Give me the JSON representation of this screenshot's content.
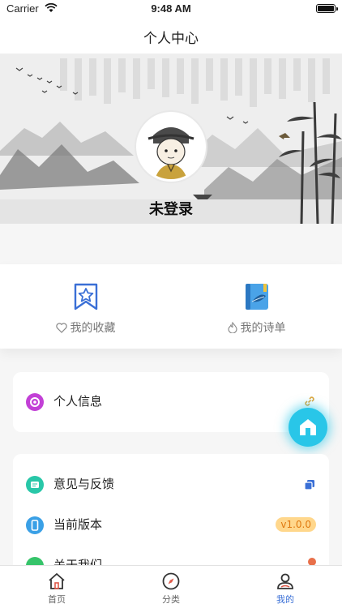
{
  "status_bar": {
    "carrier": "Carrier",
    "time": "9:48 AM"
  },
  "nav": {
    "title": "个人中心"
  },
  "banner": {
    "login_label": "未登录"
  },
  "favorites": {
    "collection_label": "我的收藏",
    "poem_list_label": "我的诗单"
  },
  "menu": {
    "personal_info": "个人信息",
    "feedback": "意见与反馈",
    "version": "当前版本",
    "version_value": "v1.0.0",
    "about": "关于我们"
  },
  "tabs": [
    {
      "label": "首页",
      "icon": "home-icon",
      "active": false
    },
    {
      "label": "分类",
      "icon": "compass-icon",
      "active": false
    },
    {
      "label": "我的",
      "icon": "user-icon",
      "active": true
    }
  ],
  "colors": {
    "accent": "#3a6fd6",
    "float_button": "#29c6e8",
    "version_badge_bg": "#ffd78c",
    "version_badge_text": "#e07a10"
  }
}
